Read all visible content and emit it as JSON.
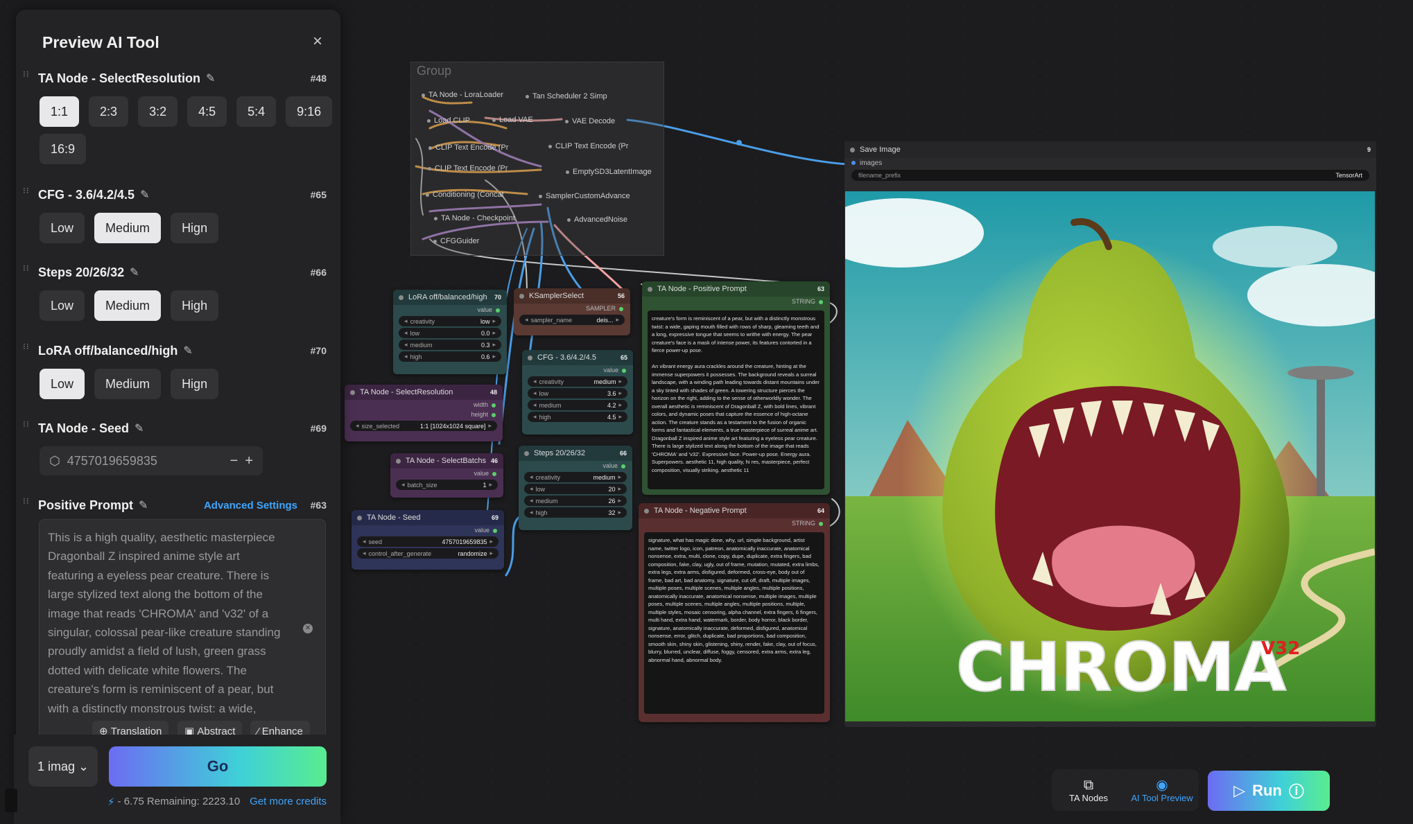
{
  "panel": {
    "title": "Preview AI Tool",
    "sections": [
      {
        "title": "TA Node - SelectResolution",
        "id": "#48",
        "options": [
          "1:1",
          "2:3",
          "3:2",
          "4:5",
          "5:4",
          "9:16",
          "16:9"
        ],
        "selected": "1:1"
      },
      {
        "title": "CFG - 3.6/4.2/4.5",
        "id": "#65",
        "options": [
          "Low",
          "Medium",
          "Hign"
        ],
        "selected": "Medium"
      },
      {
        "title": "Steps 20/26/32",
        "id": "#66",
        "options": [
          "Low",
          "Medium",
          "High"
        ],
        "selected": "Medium"
      },
      {
        "title": "LoRA off/balanced/high",
        "id": "#70",
        "options": [
          "Low",
          "Medium",
          "Hign"
        ],
        "selected": "Low"
      },
      {
        "title": "TA Node - Seed",
        "id": "#69",
        "seed": "4757019659835",
        "minus": "−",
        "plus": "+"
      },
      {
        "title": "Positive Prompt",
        "id": "#63",
        "advanced": "Advanced Settings"
      }
    ],
    "prompt_text": "This is a high quality, aesthetic masterpiece Dragonball Z inspired anime style art featuring a eyeless pear creature. There is large stylized text along the bottom of the image that reads 'CHROMA' and 'v32' of a singular, colossal pear-like creature standing proudly amidst a field of lush, green grass dotted with delicate white flowers. The creature's form is reminiscent of a pear, but with a distinctly monstrous twist: a wide,",
    "tools": [
      "Translation",
      "Abstract",
      "Enhance"
    ],
    "image_count": "1 imag",
    "go_label": "Go",
    "credits": {
      "cost": "- 6.75",
      "remaining": "Remaining: 2223.10",
      "more": "Get more credits"
    }
  },
  "canvas": {
    "group_title": "Group",
    "mini_nodes": [
      "TA Node - LoraLoader",
      "Tan Scheduler 2 Simp",
      "Load CLIP",
      "Load VAE",
      "VAE Decode",
      "CLIP Text Encode (Pr",
      "CLIP Text Encode (Pr",
      "CLIP Text Encode (Pr",
      "EmptySD3LatentImage",
      "Conditioning (Concat",
      "SamplerCustomAdvance",
      "TA Node - Checkpoint",
      "AdvancedNoise",
      "CFGGuider"
    ],
    "lora": {
      "title": "LoRA off/balanced/high",
      "id": "70",
      "out": "value",
      "rows": [
        [
          "creativity",
          "low"
        ],
        [
          "low",
          "0.0"
        ],
        [
          "medium",
          "0.3"
        ],
        [
          "high",
          "0.6"
        ]
      ]
    },
    "ksampler": {
      "title": "KSamplerSelect",
      "id": "56",
      "out": "SAMPLER",
      "rows": [
        [
          "sampler_name",
          "deis..."
        ]
      ]
    },
    "cfg": {
      "title": "CFG - 3.6/4.2/4.5",
      "id": "65",
      "out": "value",
      "rows": [
        [
          "creativity",
          "medium"
        ],
        [
          "low",
          "3.6"
        ],
        [
          "medium",
          "4.2"
        ],
        [
          "high",
          "4.5"
        ]
      ]
    },
    "selres": {
      "title": "TA Node - SelectResolution",
      "id": "48",
      "outs": [
        "width",
        "height"
      ],
      "rows": [
        [
          "size_selected",
          "1:1 [1024x1024 square]"
        ]
      ]
    },
    "batch": {
      "title": "TA Node - SelectBatchs",
      "id": "46",
      "out": "value",
      "rows": [
        [
          "batch_size",
          "1"
        ]
      ]
    },
    "steps": {
      "title": "Steps 20/26/32",
      "id": "66",
      "out": "value",
      "rows": [
        [
          "creativity",
          "medium"
        ],
        [
          "low",
          "20"
        ],
        [
          "medium",
          "26"
        ],
        [
          "high",
          "32"
        ]
      ]
    },
    "seed": {
      "title": "TA Node - Seed",
      "id": "69",
      "out": "value",
      "rows": [
        [
          "seed",
          "4757019659835"
        ],
        [
          "control_after_generate",
          "randomize"
        ]
      ]
    },
    "pos": {
      "title": "TA Node - Positive Prompt",
      "id": "63",
      "out": "STRING",
      "text": "creature's form is reminiscent of a pear, but with a distinctly monstrous twist: a wide, gaping mouth filled with rows of sharp, gleaming teeth and a long, expressive tongue that seems to writhe with energy. The pear creature's face is a mask of intense power, its features contorted in a fierce power-up pose.\n\nAn vibrant energy aura crackles around the creature, hinting at the immense superpowers it possesses. The background reveals a surreal landscape, with a winding path leading towards distant mountains under a sky tinted with shades of green. A towering structure pierces the horizon on the right, adding to the sense of otherworldly wonder. The overall aesthetic is reminiscent of Dragonball Z, with bold lines, vibrant colors, and dynamic poses that capture the essence of high-octane action. The creature stands as a testament to the fusion of organic forms and fantastical elements, a true masterpiece of surreal anime art.\nDragonball Z inspired anime style art featuring a eyeless pear creature. There is large stylized text along the bottom of the image that reads 'CHROMA' and 'v32'. Expressive face. Power-up pose. Energy aura. Superpowers. aesthetic 11, high quality, hi res, masterpiece, perfect composition, visually striking. aesthetic 11"
    },
    "neg": {
      "title": "TA Node - Negative Prompt",
      "id": "64",
      "out": "STRING",
      "text": "signature, what has magic done, why, url, simple background, artist name, twitter logo, icon, patreon, anatomically inaccurate, anatomical nonsense, extra, multi, clone, copy, dupe, duplicate, extra fingers, bad composition, fake, clay, ugly, out of frame, mutation, mutated, extra limbs, extra legs, extra arms, disfigured, deformed, cross-eye, body out of frame, bad art, bad anatomy, signature, cut off, draft, multiple images, multiple poses, multiple scenes, multiple angles, multiple positions, anatomically inaccurate, anatomical nonsense, multiple images, multiple poses, multiple scenes, multiple angles, multiple positions, multiple, multiple styles, mosaic censoring, alpha channel, extra fingers, 6 fingers, multi hand, extra hand, watermark, border, body horror, black border, signature, anatomically inaccurate, deformed, disfigured, anatomical nonsense, error, glitch, duplicate, bad proportions, bad composition, smooth skin, shiny skin, glistening, shiny, render, fake, clay, out of focus, blurry, blurred, unclear, diffuse, foggy, censored, extra arms, extra leg, abnormal hand, abnormal body."
    },
    "save": {
      "title": "Save Image",
      "id": "9",
      "input": "images",
      "prefix_label": "filename_prefix",
      "prefix_value": "TensorArt"
    },
    "art_text": {
      "main": "CHROMA",
      "sub": "V32"
    }
  },
  "dock": {
    "nodes_label": "TA Nodes",
    "preview_label": "AI Tool Preview"
  },
  "run_label": "Run",
  "colors": {
    "accent": "#3ea6ff",
    "gradient_start": "#6c6cf2",
    "gradient_end": "#59ed8f"
  }
}
